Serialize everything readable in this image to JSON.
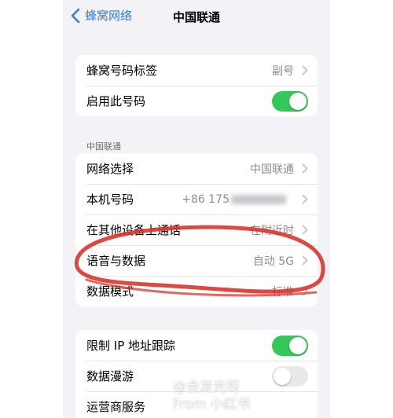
{
  "nav": {
    "back_label": "蜂窝网络",
    "title": "中国联通"
  },
  "group1": {
    "items": [
      {
        "label": "蜂窝号码标签",
        "value": "副号"
      },
      {
        "label": "启用此号码",
        "toggle": "on"
      }
    ]
  },
  "section_header": "中国联通",
  "group2": {
    "items": [
      {
        "label": "网络选择",
        "value": "中国联通"
      },
      {
        "label": "本机号码",
        "value": "+86 175"
      },
      {
        "label": "在其他设备上通话",
        "value": "在附近时"
      },
      {
        "label": "语音与数据",
        "value": "自动 5G"
      },
      {
        "label": "数据模式",
        "value": "标准"
      }
    ]
  },
  "group3": {
    "items": [
      {
        "label": "限制 IP 地址跟踪",
        "toggle": "on"
      },
      {
        "label": "数据漫游",
        "toggle": "off"
      },
      {
        "label": "运营商服务"
      }
    ]
  },
  "watermark": {
    "line1": "@会发光呀",
    "line2": "From 小红书"
  },
  "colors": {
    "accent": "#2f7bf6",
    "toggle_on": "#34c759",
    "annotation": "#d9342b"
  }
}
